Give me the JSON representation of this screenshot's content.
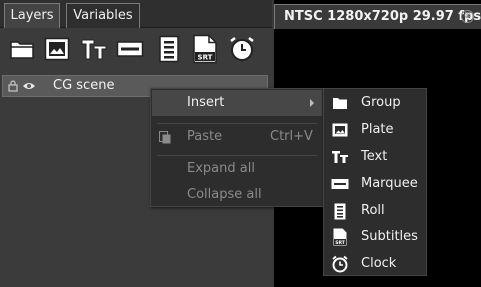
{
  "tabs": [
    {
      "label": "Layers"
    },
    {
      "label": "Variables"
    }
  ],
  "toolbar": {
    "buttons": [
      {
        "icon": "folder-icon"
      },
      {
        "icon": "image-icon"
      },
      {
        "icon": "text-icon"
      },
      {
        "icon": "marquee-icon"
      },
      {
        "icon": "roll-icon"
      },
      {
        "icon": "subtitles-icon",
        "badge": "SRT"
      },
      {
        "icon": "clock-icon"
      }
    ]
  },
  "layers": {
    "items": [
      {
        "name": "CG scene"
      }
    ]
  },
  "preview": {
    "title": "NTSC 1280x720p 29.97 fps",
    "close": "⊗"
  },
  "context_menu": {
    "insert": "Insert",
    "paste": "Paste",
    "paste_shortcut": "Ctrl+V",
    "expand_all": "Expand all",
    "collapse_all": "Collapse all"
  },
  "insert_submenu": {
    "items": [
      {
        "label": "Group",
        "icon": "folder-icon"
      },
      {
        "label": "Plate",
        "icon": "image-icon"
      },
      {
        "label": "Text",
        "icon": "text-icon"
      },
      {
        "label": "Marquee",
        "icon": "marquee-icon"
      },
      {
        "label": "Roll",
        "icon": "roll-icon"
      },
      {
        "label": "Subtitles",
        "icon": "subtitles-icon",
        "badge": "SRT"
      },
      {
        "label": "Clock",
        "icon": "clock-icon"
      }
    ]
  },
  "colors": {
    "panel_bg": "#3b3b3b",
    "menu_bg": "#2d2d2d",
    "highlight": "#474747",
    "preview_bg": "#000000"
  }
}
